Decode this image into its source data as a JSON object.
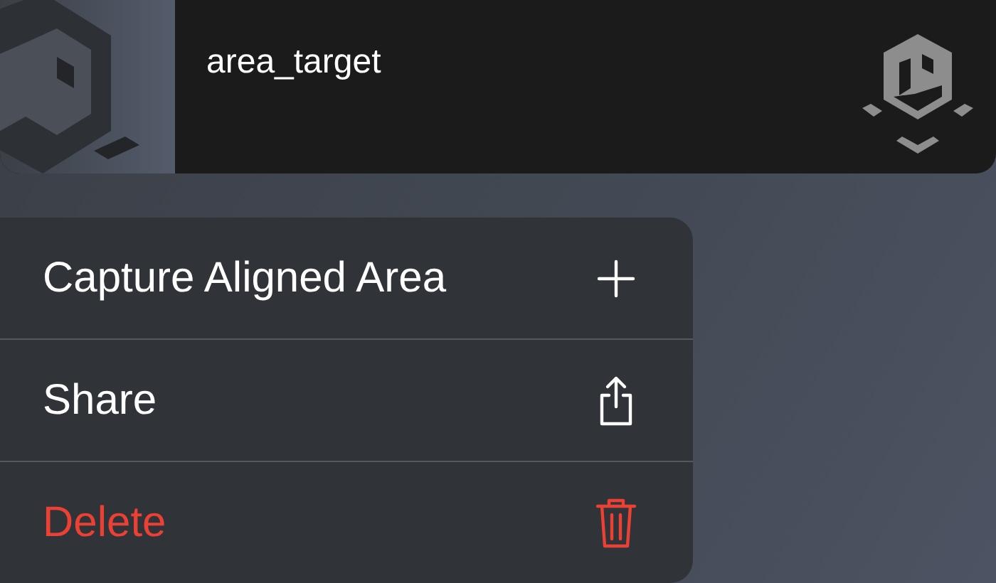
{
  "item_card": {
    "title": "area_target"
  },
  "context_menu": [
    {
      "kind": "add",
      "label": "Capture Aligned Area",
      "destructive": false
    },
    {
      "kind": "share",
      "label": "Share",
      "destructive": false
    },
    {
      "kind": "delete",
      "label": "Delete",
      "destructive": true
    }
  ]
}
